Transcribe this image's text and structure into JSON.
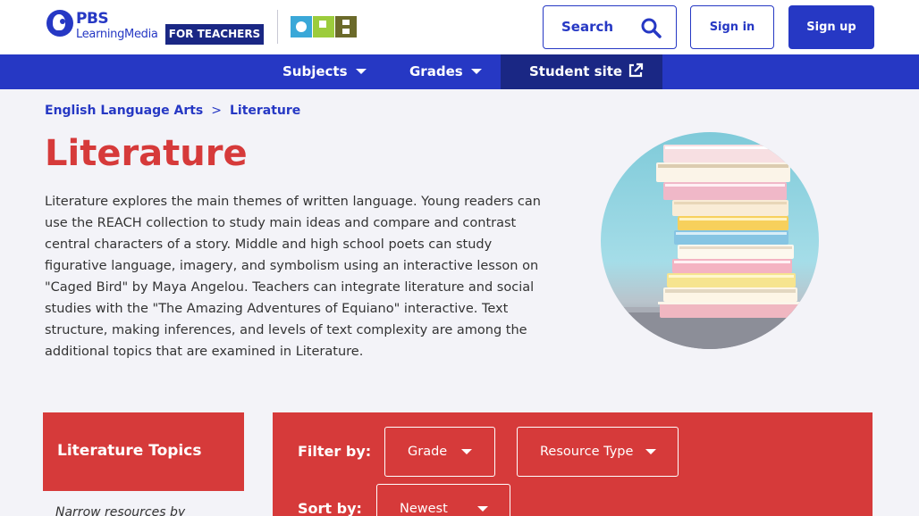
{
  "header": {
    "logo_brand": "PBS",
    "logo_sub": "LearningMedia",
    "badge": "FOR TEACHERS",
    "partner_logo": "OPB",
    "search_label": "Search",
    "signin_label": "Sign in",
    "signup_label": "Sign up"
  },
  "nav": {
    "subjects": "Subjects",
    "grades": "Grades",
    "student_site": "Student site"
  },
  "breadcrumb": {
    "parent": "English Language Arts",
    "separator": ">",
    "current": "Literature"
  },
  "page": {
    "title": "Literature",
    "description": "Literature explores the main themes of written language. Young readers can use the REACH collection to study main ideas and compare and contrast central characters of a story. Middle and high school poets can study figurative language, imagery, and symbolism using an interactive lesson on \"Caged Bird\" by Maya Angelou. Teachers can integrate literature and social studies with the \"The Amazing Adventures of Equiano\" interactive. Text structure, making inferences, and levels of text complexity are among the additional topics that are examined in Literature."
  },
  "topics": {
    "title": "Literature Topics",
    "hint": "Narrow resources by"
  },
  "filters": {
    "filter_label": "Filter by:",
    "grade": "Grade",
    "resource_type": "Resource Type",
    "sort_label": "Sort by:",
    "sort_value": "Newest"
  },
  "icons": {
    "search": "search-icon",
    "external": "external-link-icon",
    "caret": "caret-down-icon"
  },
  "colors": {
    "brand_blue": "#2638c4",
    "dark_blue": "#1a2784",
    "accent_red": "#d63a3a",
    "page_bg": "#f3f3f8"
  }
}
